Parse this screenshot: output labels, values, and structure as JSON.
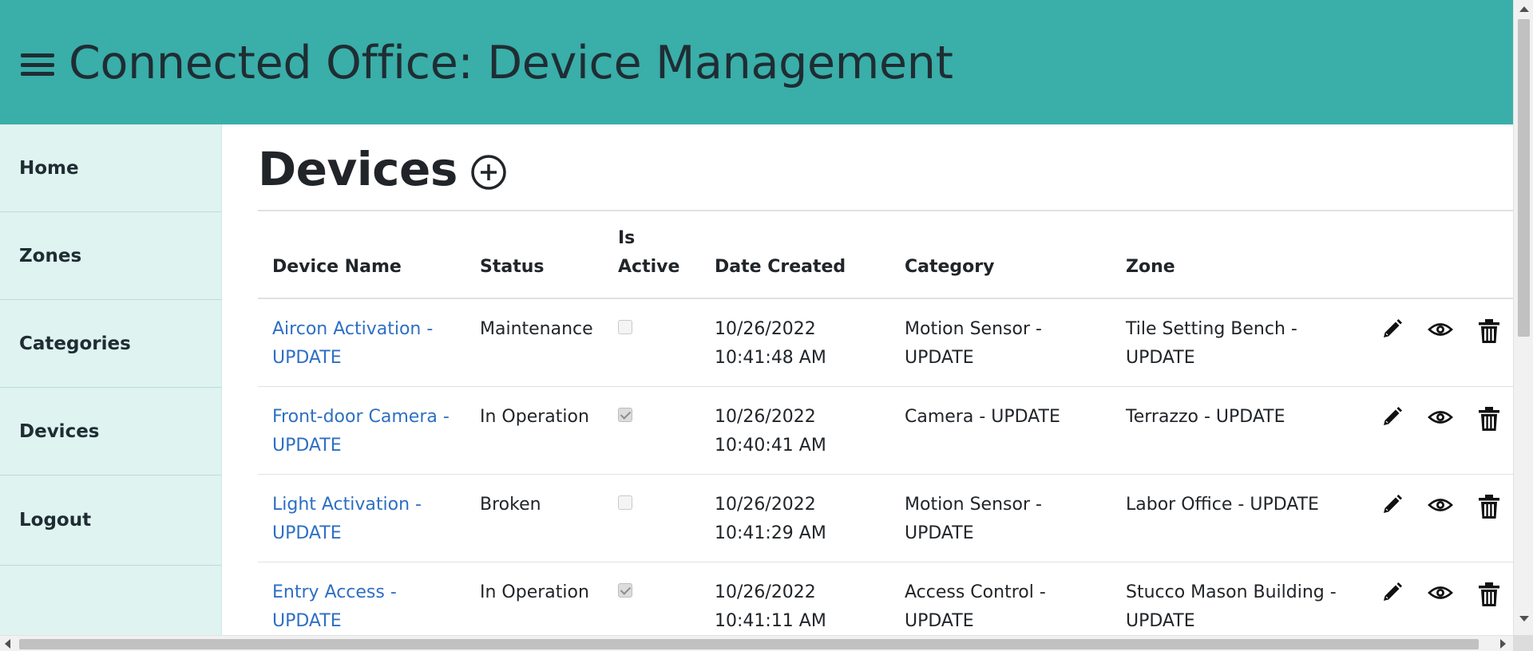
{
  "header": {
    "menu_icon": "hamburger-menu-icon",
    "title": "Connected Office: Device Management",
    "background": "#3aaea9"
  },
  "sidebar": {
    "background": "#dff3f1",
    "items": [
      {
        "label": "Home"
      },
      {
        "label": "Zones"
      },
      {
        "label": "Categories"
      },
      {
        "label": "Devices"
      },
      {
        "label": "Logout"
      }
    ]
  },
  "main": {
    "title": "Devices",
    "add_icon": "plus-circle-icon",
    "table": {
      "columns": {
        "name": "Device Name",
        "status": "Status",
        "active_line1": "Is",
        "active_line2": "Active",
        "date": "Date Created",
        "category": "Category",
        "zone": "Zone"
      },
      "rows": [
        {
          "name_line1": "Aircon Activation -",
          "name_line2": "UPDATE",
          "status": "Maintenance",
          "is_active": false,
          "date_line1": "10/26/2022",
          "date_line2": "10:41:48 AM",
          "category_line1": "Motion Sensor -",
          "category_line2": "UPDATE",
          "zone_line1": "Tile Setting Bench -",
          "zone_line2": "UPDATE"
        },
        {
          "name_line1": "Front-door Camera -",
          "name_line2": "UPDATE",
          "status": "In Operation",
          "is_active": true,
          "date_line1": "10/26/2022",
          "date_line2": "10:40:41 AM",
          "category_line1": "Camera - UPDATE",
          "category_line2": "",
          "zone_line1": "Terrazzo - UPDATE",
          "zone_line2": ""
        },
        {
          "name_line1": "Light Activation -",
          "name_line2": "UPDATE",
          "status": "Broken",
          "is_active": false,
          "date_line1": "10/26/2022",
          "date_line2": "10:41:29 AM",
          "category_line1": "Motion Sensor -",
          "category_line2": "UPDATE",
          "zone_line1": "Labor Office - UPDATE",
          "zone_line2": ""
        },
        {
          "name_line1": "Entry Access -",
          "name_line2": "UPDATE",
          "status": "In Operation",
          "is_active": true,
          "date_line1": "10/26/2022",
          "date_line2": "10:41:11 AM",
          "category_line1": "Access Control -",
          "category_line2": "UPDATE",
          "zone_line1": "Stucco Mason Building -",
          "zone_line2": "UPDATE"
        }
      ],
      "row_actions": [
        "pencil-edit-icon",
        "eye-view-icon",
        "trash-delete-icon"
      ]
    }
  },
  "colors": {
    "link": "#2d6fc4",
    "text": "#212529"
  }
}
